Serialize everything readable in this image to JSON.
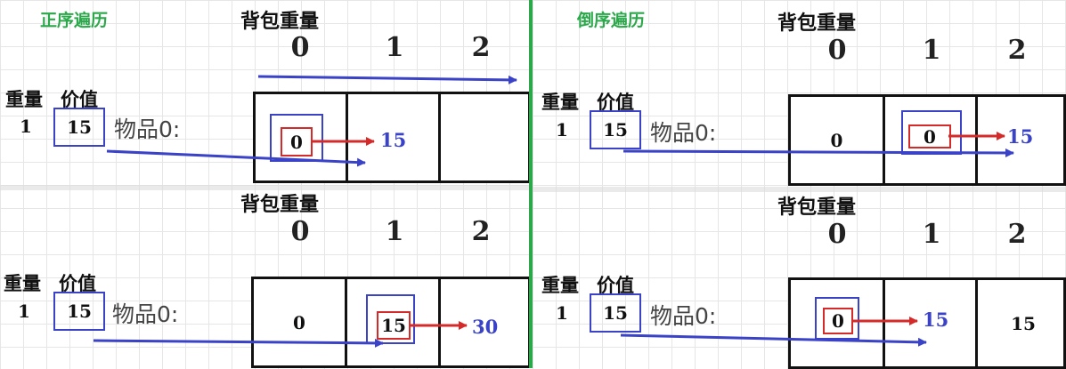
{
  "titles": {
    "forward": "正序遍历",
    "backward": "倒序遍历"
  },
  "capacity_label": "背包重量",
  "capacity_indices": [
    "0",
    "1",
    "2"
  ],
  "item_headers": {
    "weight": "重量",
    "value": "价值"
  },
  "item": {
    "weight": "1",
    "value": "15",
    "label": "物品0:"
  },
  "panels": {
    "forward_step1": {
      "cells": [
        "",
        "",
        ""
      ],
      "highlight": "0",
      "result": "15"
    },
    "forward_step2": {
      "cells": [
        "0",
        "",
        ""
      ],
      "highlight": "15",
      "result": "30"
    },
    "backward_step1": {
      "cells": [
        "0",
        "",
        ""
      ],
      "highlight": "0",
      "result": "15"
    },
    "backward_step2": {
      "cells": [
        "",
        "",
        "15"
      ],
      "highlight": "0",
      "result": "15"
    }
  },
  "colors": {
    "title": "#2aa84a",
    "blue": "#3a42c8",
    "red": "#d42a2a",
    "divider": "#2aa84a"
  }
}
